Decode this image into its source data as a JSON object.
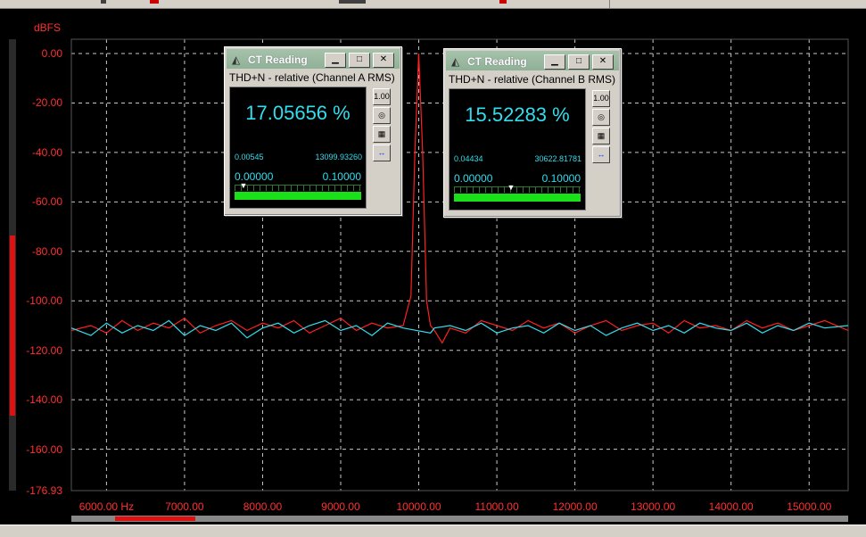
{
  "plot": {
    "unit": "dBFS",
    "y_labels": [
      "0.00",
      "-20.00",
      "-40.00",
      "-60.00",
      "-80.00",
      "-100.00",
      "-120.00",
      "-140.00",
      "-160.00",
      "-176.93"
    ],
    "x_labels": [
      "6000.00 Hz",
      "7000.00",
      "8000.00",
      "9000.00",
      "10000.00",
      "11000.00",
      "12000.00",
      "13000.00",
      "14000.00",
      "15000.00"
    ]
  },
  "colors": {
    "channel_a": "#ff2020",
    "channel_b": "#33ddee",
    "grid": "#c8c8c8",
    "labels": "#ff3030"
  },
  "chart_data": {
    "type": "line",
    "xlabel": "",
    "ylabel": "dBFS",
    "xlim": [
      5550,
      15500
    ],
    "ylim": [
      -176.93,
      0
    ],
    "grid": true,
    "series": [
      {
        "color": "#ff2020",
        "x": [
          5550,
          5800,
          6000,
          6200,
          6400,
          6600,
          6800,
          7000,
          7200,
          7400,
          7600,
          7800,
          8000,
          8200,
          8400,
          8600,
          8800,
          9000,
          9200,
          9400,
          9600,
          9800,
          9900,
          9950,
          10000,
          10050,
          10100,
          10150,
          10200,
          10300,
          10400,
          10600,
          10800,
          11000,
          11200,
          11400,
          11600,
          11800,
          12000,
          12200,
          12400,
          12600,
          12800,
          13000,
          13200,
          13400,
          13600,
          13800,
          14000,
          14200,
          14400,
          14600,
          14800,
          15000,
          15200,
          15500
        ],
        "y": [
          -112,
          -110,
          -113,
          -108,
          -112,
          -109,
          -111,
          -107,
          -113,
          -110,
          -108,
          -112,
          -109,
          -111,
          -108,
          -113,
          -110,
          -107,
          -112,
          -109,
          -111,
          -110,
          -98,
          -40,
          0,
          -40,
          -100,
          -110,
          -112,
          -117,
          -111,
          -113,
          -108,
          -110,
          -112,
          -108,
          -111,
          -109,
          -113,
          -110,
          -108,
          -112,
          -110,
          -109,
          -113,
          -108,
          -111,
          -110,
          -112,
          -108,
          -111,
          -109,
          -112,
          -110,
          -108,
          -112
        ]
      },
      {
        "color": "#33ddee",
        "x": [
          5550,
          5800,
          6000,
          6200,
          6400,
          6600,
          6800,
          7000,
          7200,
          7400,
          7600,
          7800,
          8000,
          8200,
          8400,
          8600,
          8800,
          9000,
          9200,
          9400,
          9600,
          9800,
          10150,
          10200,
          10400,
          10600,
          10800,
          11000,
          11200,
          11400,
          11600,
          11800,
          12000,
          12200,
          12400,
          12600,
          12800,
          13000,
          13200,
          13400,
          13600,
          13800,
          14000,
          14200,
          14400,
          14600,
          14800,
          15000,
          15200,
          15500
        ],
        "y": [
          -111,
          -114,
          -109,
          -113,
          -110,
          -112,
          -108,
          -114,
          -110,
          -112,
          -109,
          -115,
          -111,
          -109,
          -113,
          -110,
          -108,
          -112,
          -110,
          -114,
          -109,
          -111,
          -113,
          -111,
          -110,
          -112,
          -109,
          -113,
          -111,
          -110,
          -113,
          -109,
          -112,
          -110,
          -114,
          -111,
          -109,
          -112,
          -110,
          -113,
          -109,
          -111,
          -112,
          -109,
          -113,
          -110,
          -112,
          -109,
          -111,
          -110
        ]
      }
    ]
  },
  "windows": [
    {
      "title": "CT Reading",
      "subtitle": "THD+N - relative (Channel A RMS)",
      "reading": "17.05656 %",
      "min": "0.00545",
      "max": "13099.93260",
      "range_min": "0.00000",
      "range_max": "0.10000",
      "bar_level": 1.0,
      "marker_position": 0.06
    },
    {
      "title": "CT Reading",
      "subtitle": "THD+N - relative (Channel B RMS)",
      "reading": "15.52283 %",
      "min": "0.04434",
      "max": "30622.81781",
      "range_min": "0.00000",
      "range_max": "0.10000",
      "bar_level": 1.0,
      "marker_position": 0.44
    }
  ],
  "window_buttons": {
    "minimize": "▁",
    "maximize": "□",
    "close": "✕"
  },
  "tool_icons": [
    "scale-100-icon",
    "dial-icon",
    "settings-edit-icon",
    "expand-arrows-icon"
  ],
  "tool_glyphs": [
    "1.00",
    "◎",
    "▦",
    "↔"
  ]
}
